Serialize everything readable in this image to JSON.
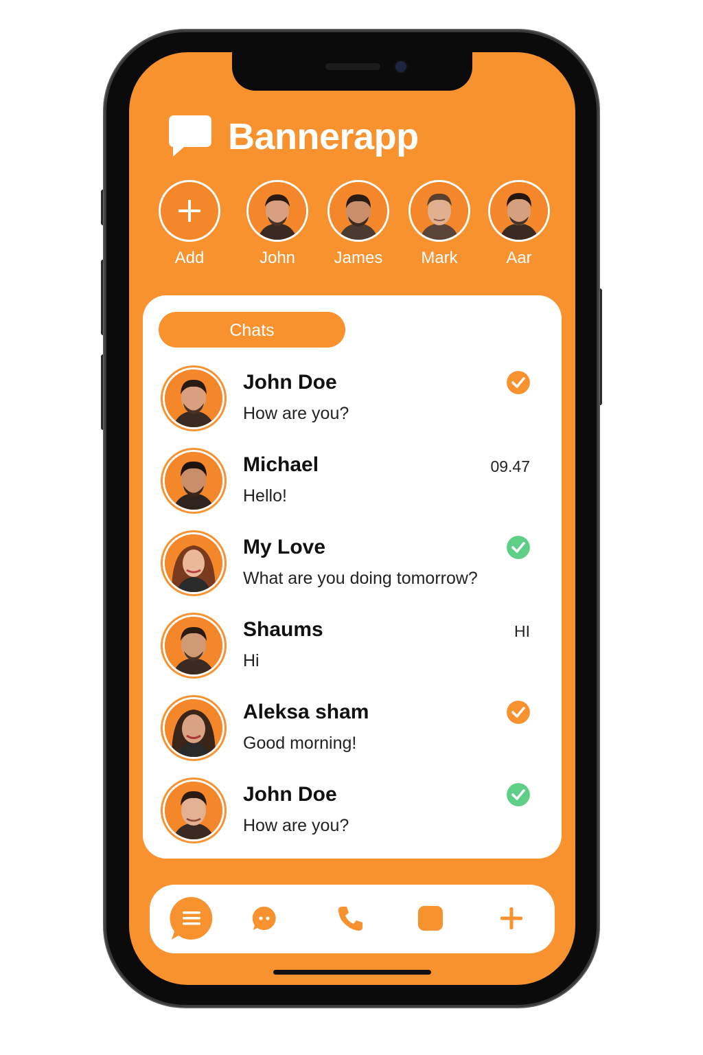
{
  "app": {
    "title": "Bannerapp"
  },
  "stories": [
    {
      "label": "Add",
      "icon": "plus-icon"
    },
    {
      "label": "John"
    },
    {
      "label": "James"
    },
    {
      "label": "Mark"
    },
    {
      "label": "Aar"
    }
  ],
  "tabs": {
    "active": "Chats"
  },
  "chats": [
    {
      "name": "John Doe",
      "message": "How are you?",
      "meta": "",
      "status": "read-orange"
    },
    {
      "name": "Michael",
      "message": "Hello!",
      "meta": "09.47",
      "status": ""
    },
    {
      "name": "My Love",
      "message": "What are you doing tomorrow?",
      "meta": "",
      "status": "read-green"
    },
    {
      "name": "Shaums",
      "message": "Hi",
      "meta": "HI",
      "status": ""
    },
    {
      "name": "Aleksa sham",
      "message": "Good morning!",
      "meta": "",
      "status": "read-orange"
    },
    {
      "name": "John Doe",
      "message": "How are you?",
      "meta": "",
      "status": "read-green"
    }
  ],
  "nav": [
    {
      "icon": "menu-icon",
      "active": true
    },
    {
      "icon": "chat-bubble-icon",
      "active": false
    },
    {
      "icon": "phone-icon",
      "active": false
    },
    {
      "icon": "square-icon",
      "active": false
    },
    {
      "icon": "plus-icon",
      "active": false
    }
  ],
  "colors": {
    "accent": "#f7922f",
    "check_orange": "#f7922f",
    "check_green": "#5fcf87"
  }
}
